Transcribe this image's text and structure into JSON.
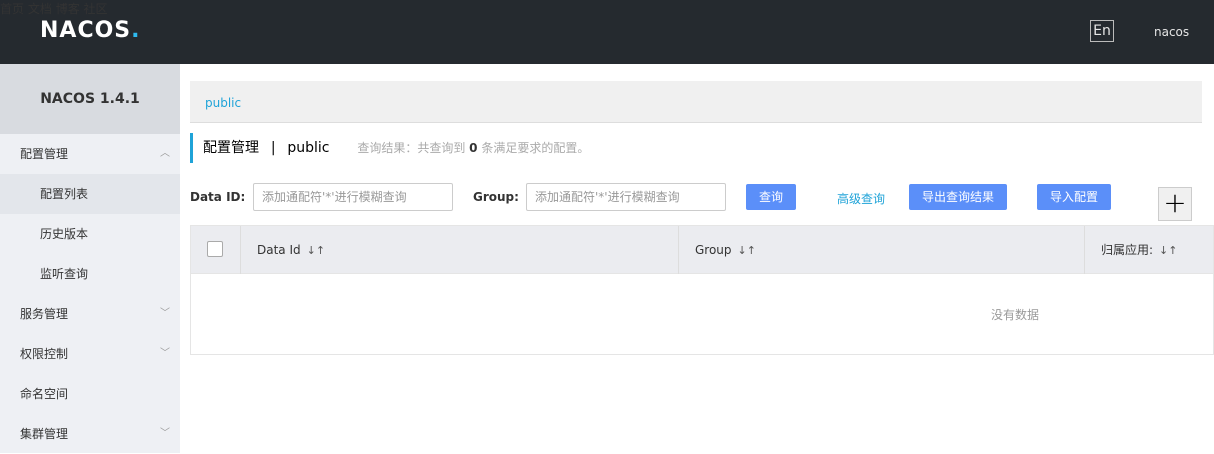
{
  "header": {
    "logo_text_a": "NA",
    "logo_text_b": "OS",
    "logo_dot": ".",
    "nav": [
      "首页",
      "文档",
      "博客",
      "社区"
    ],
    "lang": "En",
    "user": "nacos"
  },
  "sidebar": {
    "brand": "NACOS 1.4.1",
    "items": [
      {
        "label": "配置管理"
      },
      {
        "label": "配置列表"
      },
      {
        "label": "历史版本"
      },
      {
        "label": "监听查询"
      },
      {
        "label": "服务管理"
      },
      {
        "label": "权限控制"
      },
      {
        "label": "命名空间"
      },
      {
        "label": "集群管理"
      }
    ]
  },
  "namespace": {
    "current": "public"
  },
  "title": {
    "main": "配置管理",
    "sep": "|",
    "ns": "public",
    "result_prefix": "查询结果：共查询到",
    "result_count": "0",
    "result_suffix": "条满足要求的配置。"
  },
  "search": {
    "dataid_label": "Data ID:",
    "dataid_placeholder": "添加通配符'*'进行模糊查询",
    "group_label": "Group:",
    "group_placeholder": "添加通配符'*'进行模糊查询",
    "query_button": "查询",
    "advanced_link": "高级查询",
    "export_button": "导出查询结果",
    "import_button": "导入配置",
    "add_symbol": "+"
  },
  "table": {
    "columns": [
      "Data Id",
      "Group",
      "归属应用:"
    ],
    "sort_symbol": "↓↑",
    "empty_text": "没有数据"
  },
  "colors": {
    "topbar": "#252a2f",
    "accent": "#1fa3d8",
    "button": "#5b8ff9"
  }
}
